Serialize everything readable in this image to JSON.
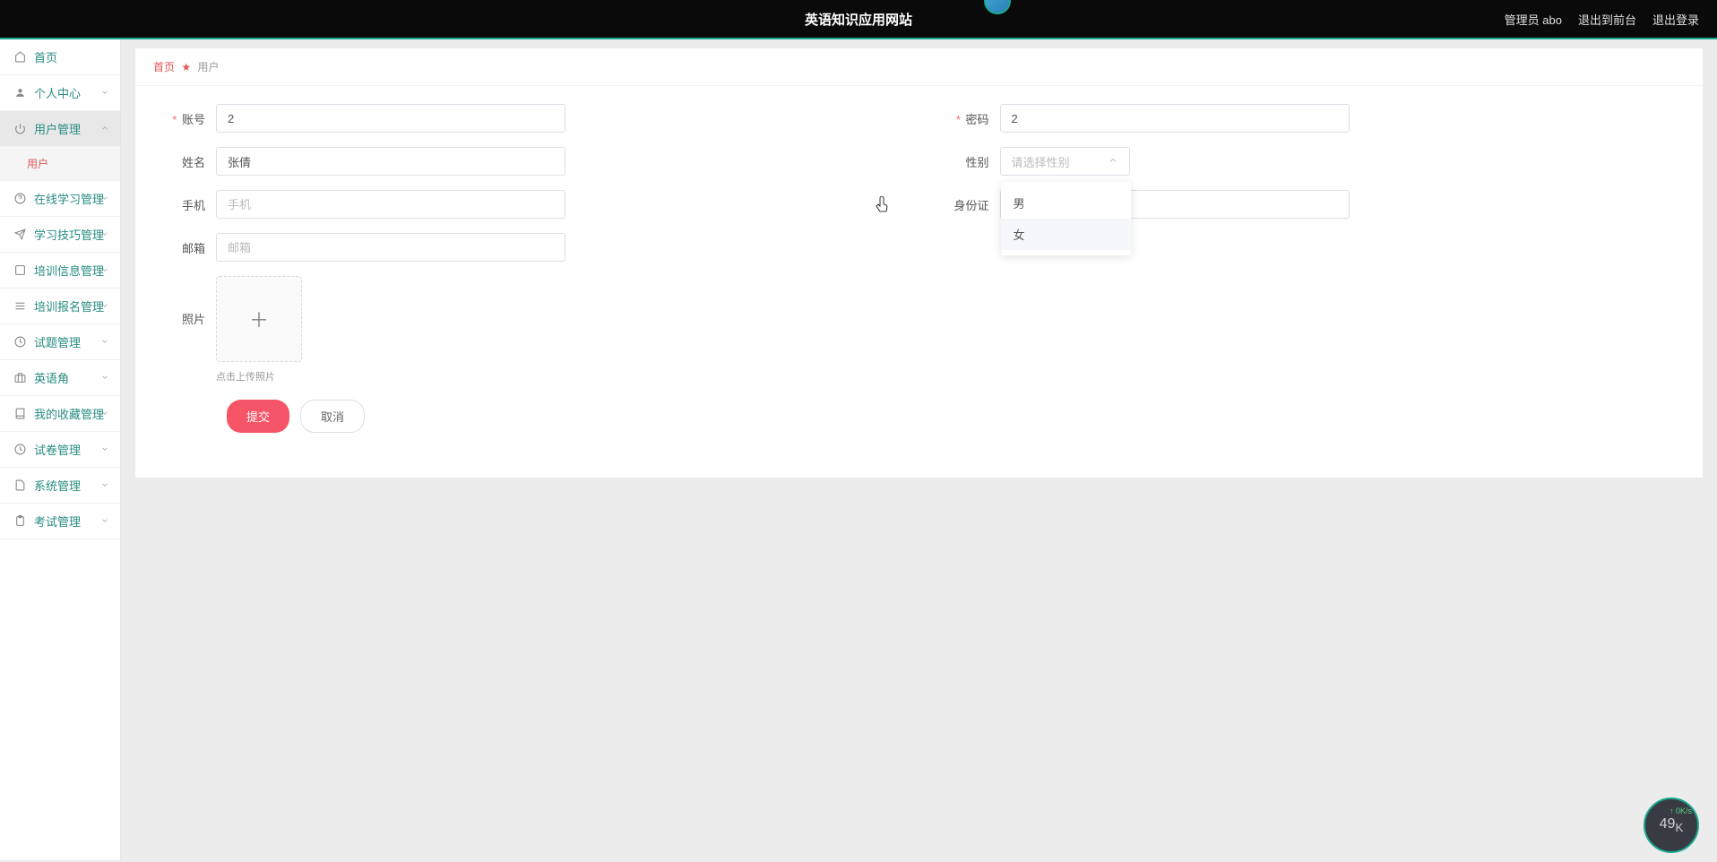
{
  "header": {
    "title": "英语知识应用网站",
    "admin_label": "管理员 abo",
    "exit_front": "退出到前台",
    "logout": "退出登录"
  },
  "sidebar": {
    "items": [
      {
        "label": "首页",
        "icon": "home",
        "chevron": false
      },
      {
        "label": "个人中心",
        "icon": "user",
        "chevron": true
      },
      {
        "label": "用户管理",
        "icon": "power",
        "chevron": true,
        "expanded": true
      },
      {
        "label": "在线学习管理",
        "icon": "help",
        "chevron": true
      },
      {
        "label": "学习技巧管理",
        "icon": "send",
        "chevron": true
      },
      {
        "label": "培训信息管理",
        "icon": "box",
        "chevron": true
      },
      {
        "label": "培训报名管理",
        "icon": "list",
        "chevron": true
      },
      {
        "label": "试题管理",
        "icon": "clock",
        "chevron": true
      },
      {
        "label": "英语角",
        "icon": "case",
        "chevron": true
      },
      {
        "label": "我的收藏管理",
        "icon": "book",
        "chevron": true
      },
      {
        "label": "试卷管理",
        "icon": "clock",
        "chevron": true
      },
      {
        "label": "系统管理",
        "icon": "doc",
        "chevron": true
      },
      {
        "label": "考试管理",
        "icon": "clip",
        "chevron": true
      }
    ],
    "subitem": "用户"
  },
  "breadcrumb": {
    "home": "首页",
    "current": "用户"
  },
  "form": {
    "account_label": "账号",
    "account_value": "2",
    "password_label": "密码",
    "password_value": "2",
    "name_label": "姓名",
    "name_value": "张倩",
    "gender_label": "性别",
    "gender_placeholder": "请选择性别",
    "gender_options": [
      "男",
      "女"
    ],
    "phone_label": "手机",
    "phone_placeholder": "手机",
    "idcard_label": "身份证",
    "email_label": "邮箱",
    "email_placeholder": "邮箱",
    "photo_label": "照片",
    "upload_hint": "点击上传照片",
    "submit": "提交",
    "cancel": "取消"
  },
  "netwidget": {
    "main": "49",
    "unit": "K",
    "speed": "0K/s"
  }
}
